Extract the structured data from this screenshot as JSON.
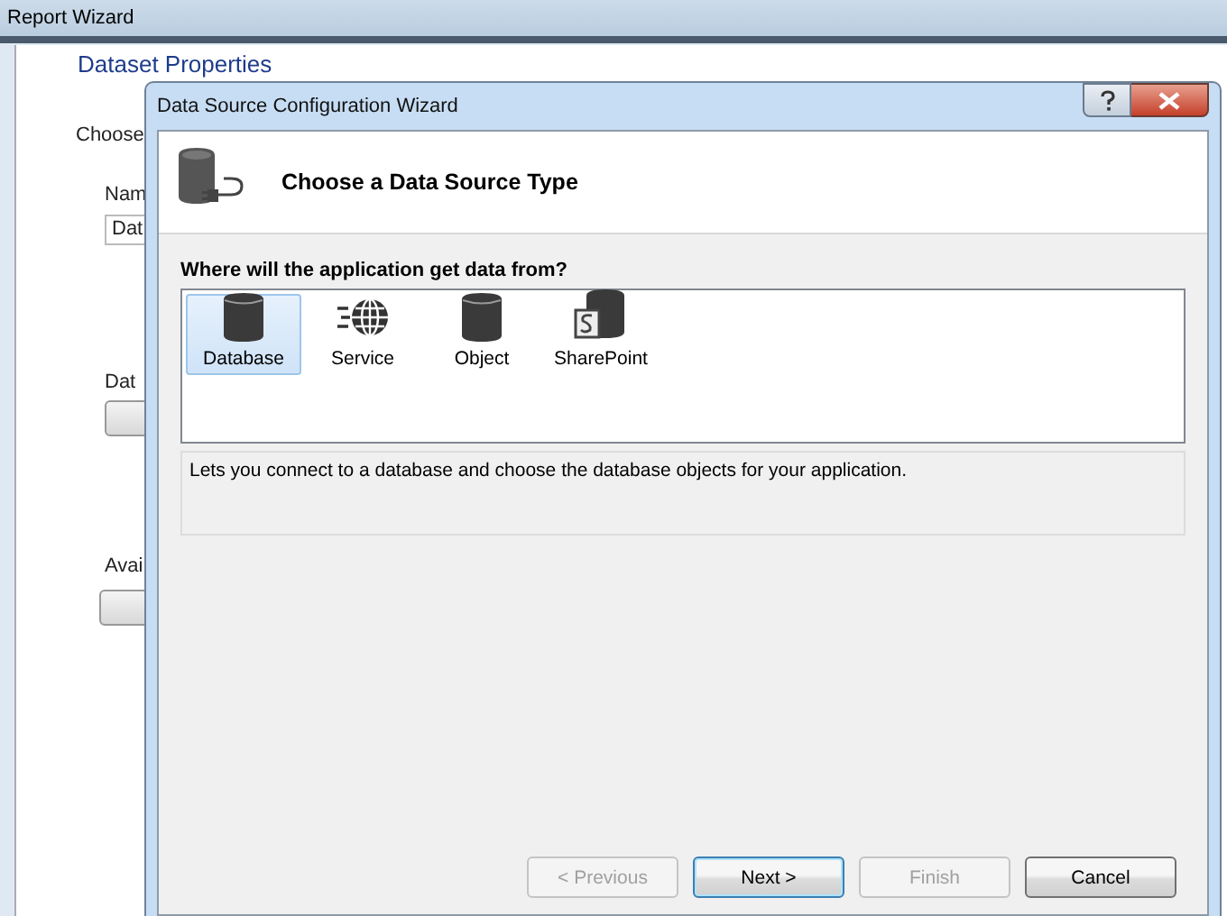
{
  "background_window": {
    "title": "Report Wizard",
    "heading": "Dataset Properties",
    "labels": [
      "Choose",
      "Nam"
    ],
    "name_value": "Dat",
    "labels_below": [
      "Dat",
      "Avai"
    ]
  },
  "dialog": {
    "title": "Data Source Configuration Wizard",
    "heading": "Choose a Data Source Type",
    "question": "Where will the application get data from?",
    "items": [
      {
        "label": "Database",
        "kind": "database",
        "selected": true
      },
      {
        "label": "Service",
        "kind": "service",
        "selected": false
      },
      {
        "label": "Object",
        "kind": "object",
        "selected": false
      },
      {
        "label": "SharePoint",
        "kind": "sharepoint",
        "selected": false
      }
    ],
    "description": "Lets you connect to a database and choose the database objects for your application.",
    "buttons": [
      {
        "label": "< Previous",
        "disabled": true,
        "default": false
      },
      {
        "label": "Next >",
        "disabled": false,
        "default": true
      },
      {
        "label": "Finish",
        "disabled": true,
        "default": false
      },
      {
        "label": "Cancel",
        "disabled": false,
        "default": false
      }
    ]
  }
}
